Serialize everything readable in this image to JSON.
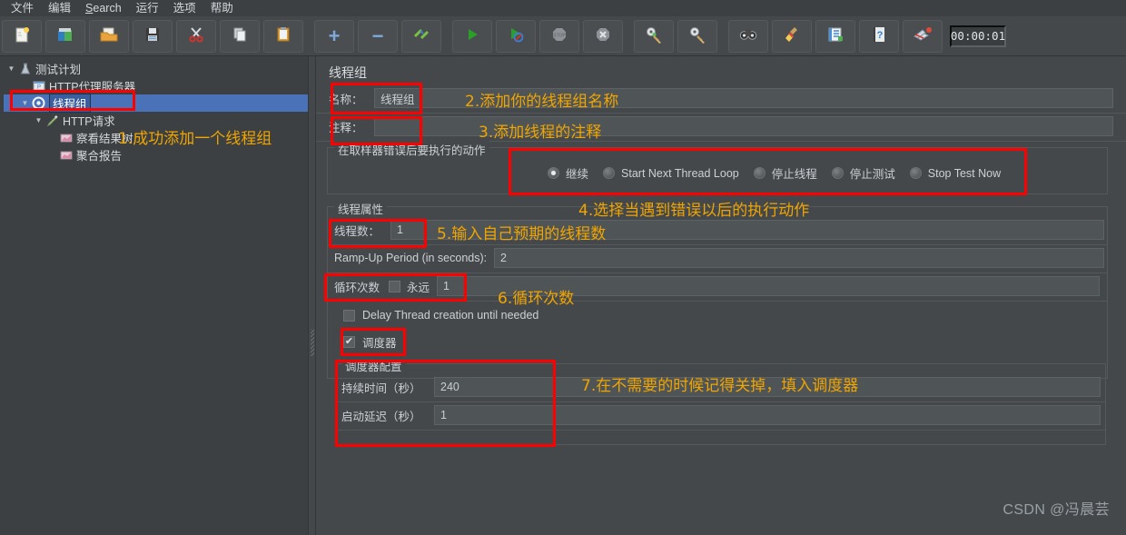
{
  "window": {
    "timer": "00:00:01",
    "watermark": "CSDN @冯晨芸"
  },
  "menubar": {
    "items": [
      {
        "label": "文件",
        "name": "menu-file"
      },
      {
        "label": "编辑",
        "name": "menu-edit"
      },
      {
        "label": "Search",
        "name": "menu-search",
        "mnemonic": "S"
      },
      {
        "label": "运行",
        "name": "menu-run"
      },
      {
        "label": "选项",
        "name": "menu-options"
      },
      {
        "label": "帮助",
        "name": "menu-help"
      }
    ]
  },
  "toolbar": {
    "buttons": [
      {
        "name": "new-button",
        "icon": "new-document-icon",
        "glyph": "🗋"
      },
      {
        "name": "templates-button",
        "icon": "templates-icon",
        "glyph": "📚"
      },
      {
        "name": "open-button",
        "icon": "open-folder-icon",
        "glyph": "📂"
      },
      {
        "name": "save-button",
        "icon": "floppy-disk-icon",
        "glyph": "💾"
      },
      {
        "name": "cut-button",
        "icon": "scissors-icon",
        "glyph": "✂"
      },
      {
        "name": "copy-button",
        "icon": "copy-icon",
        "glyph": "⧉"
      },
      {
        "name": "paste-button",
        "icon": "clipboard-icon",
        "glyph": "📋"
      },
      {
        "name": "expand-all-button",
        "icon": "plus-icon",
        "glyph": "+"
      },
      {
        "name": "collapse-all-button",
        "icon": "minus-icon",
        "glyph": "−"
      },
      {
        "name": "toggle-button",
        "icon": "toggle-pencil-icon",
        "glyph": "✎"
      },
      {
        "name": "start-button",
        "icon": "play-green-icon",
        "glyph": "▶"
      },
      {
        "name": "start-no-pauses-button",
        "icon": "play-no-pause-icon",
        "glyph": "▶"
      },
      {
        "name": "stop-button",
        "icon": "stop-sign-icon",
        "glyph": "STOP"
      },
      {
        "name": "shutdown-button",
        "icon": "shutdown-x-icon",
        "glyph": "✕"
      },
      {
        "name": "clear-button",
        "icon": "gear-broom-icon",
        "glyph": "⚙"
      },
      {
        "name": "clear-all-button",
        "icon": "broom-icon",
        "glyph": "⚙"
      },
      {
        "name": "search-button",
        "icon": "binoculars-icon",
        "glyph": "🔎"
      },
      {
        "name": "reset-search-button",
        "icon": "broom-yellow-icon",
        "glyph": "🧹"
      },
      {
        "name": "function-helper-button",
        "icon": "notebook-icon",
        "glyph": "📓"
      },
      {
        "name": "help-button",
        "icon": "help-book-icon",
        "glyph": "?"
      },
      {
        "name": "remote-stop-button",
        "icon": "remote-stop-icon",
        "glyph": "✈"
      }
    ]
  },
  "tree": {
    "nodes": [
      {
        "label": "测试计划",
        "depth": 0,
        "toggle": "▼",
        "icon": "test-plan-icon",
        "glyph": "🅰",
        "selected": false,
        "name": "tree-node-test-plan"
      },
      {
        "label": "HTTP代理服务器",
        "depth": 1,
        "toggle": "",
        "icon": "http-proxy-icon",
        "glyph": "🖥",
        "selected": false,
        "name": "tree-node-http-proxy-server"
      },
      {
        "label": "线程组",
        "depth": 1,
        "toggle": "▼",
        "icon": "thread-group-icon",
        "glyph": "⚙",
        "selected": true,
        "name": "tree-node-thread-group"
      },
      {
        "label": "HTTP请求",
        "depth": 2,
        "toggle": "▼",
        "icon": "http-request-icon",
        "glyph": "🖊",
        "selected": false,
        "name": "tree-node-http-request"
      },
      {
        "label": "察看结果树",
        "depth": 3,
        "toggle": "",
        "icon": "view-results-tree-icon",
        "glyph": "📈",
        "selected": false,
        "name": "tree-node-view-results-tree"
      },
      {
        "label": "聚合报告",
        "depth": 3,
        "toggle": "",
        "icon": "aggregate-report-icon",
        "glyph": "📈",
        "selected": false,
        "name": "tree-node-aggregate-report"
      }
    ]
  },
  "form": {
    "title": "线程组",
    "name_label": "名称：",
    "name_value": "线程组",
    "comment_label": "注释：",
    "comment_value": "",
    "error_action": {
      "group_label": "在取样器错误后要执行的动作",
      "options": [
        {
          "label": "继续",
          "selected": true,
          "name": "radio-continue"
        },
        {
          "label": "Start Next Thread Loop",
          "selected": false,
          "name": "radio-start-next-thread-loop"
        },
        {
          "label": "停止线程",
          "selected": false,
          "name": "radio-stop-thread"
        },
        {
          "label": "停止测试",
          "selected": false,
          "name": "radio-stop-test"
        },
        {
          "label": "Stop Test Now",
          "selected": false,
          "name": "radio-stop-test-now"
        }
      ]
    },
    "thread_properties": {
      "group_label": "线程属性",
      "threads_label": "线程数：",
      "threads_value": "1",
      "rampup_label": "Ramp-Up Period (in seconds):",
      "rampup_value": "2",
      "loop_label": "循环次数",
      "forever_label": "永远",
      "forever_checked": false,
      "loop_value": "1",
      "delay_label": "Delay Thread creation until needed",
      "delay_checked": false,
      "scheduler_label": "调度器",
      "scheduler_checked": true
    },
    "scheduler": {
      "group_label": "调度器配置",
      "duration_label": "持续时间（秒）",
      "duration_value": "240",
      "startup_delay_label": "启动延迟（秒）",
      "startup_delay_value": "1"
    }
  },
  "annotations": [
    {
      "text": "1.成功添加一个线程组",
      "name": "annotation-1"
    },
    {
      "text": "2.添加你的线程组名称",
      "name": "annotation-2"
    },
    {
      "text": "3.添加线程的注释",
      "name": "annotation-3"
    },
    {
      "text": "4.选择当遇到错误以后的执行动作",
      "name": "annotation-4"
    },
    {
      "text": "5.输入自己预期的线程数",
      "name": "annotation-5"
    },
    {
      "text": "6.循环次数",
      "name": "annotation-6"
    },
    {
      "text": "7.在不需要的时候记得关掉，填入调度器",
      "name": "annotation-7"
    }
  ],
  "colors": {
    "accent_annotation": "#f0a500",
    "highlight_box": "#ff0000",
    "selection": "#4a72b8",
    "background": "#44484b"
  }
}
